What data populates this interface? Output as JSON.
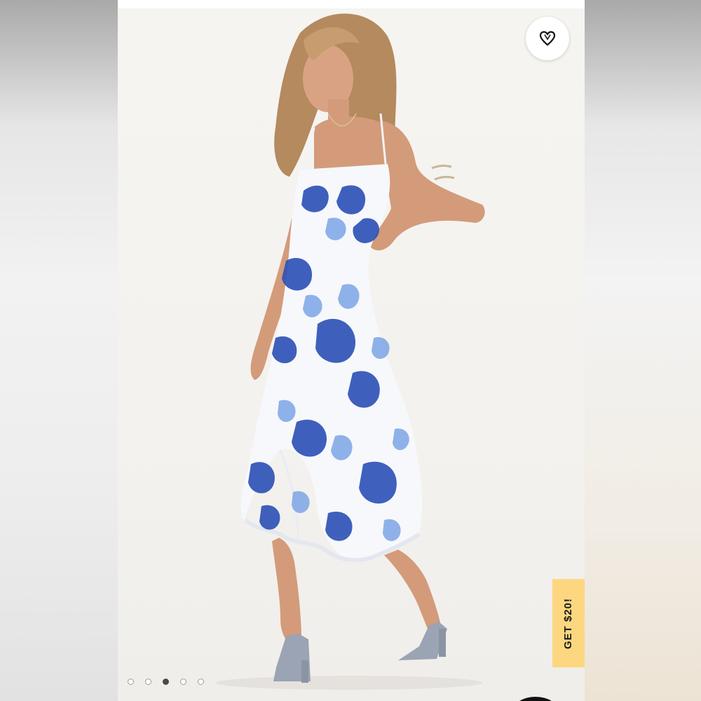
{
  "product_image": {
    "alt": "",
    "palette": {
      "dress_base": "#f7f8fb",
      "floral_dark": "#2f54b7",
      "floral_light": "#7da5e6",
      "skin": "#d8a07e",
      "hair": "#b48a5e",
      "heels": "#9aa4b4"
    }
  },
  "favorite": {
    "icon": "heart-icon"
  },
  "promo": {
    "label": "GET $20!",
    "color": "#fcd77f"
  },
  "carousel": {
    "count": 5,
    "active_index": 2
  }
}
